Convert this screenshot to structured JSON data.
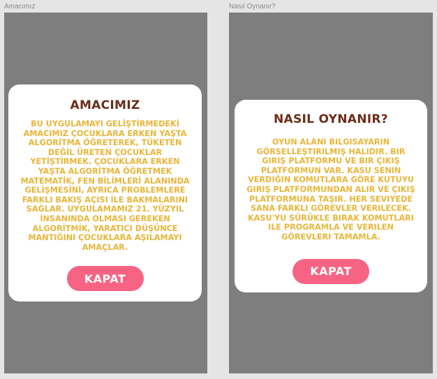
{
  "frames": [
    {
      "label": "Amacımız",
      "title": "AMACIMIZ",
      "body": "BU UYGULAMAYI GELİŞTİRMEDEKİ AMACIMIZ ÇOCUKLARA ERKEN YAŞTA ALGORİTMA ÖĞRETEREK, TÜKETEN DEĞİL ÜRETEN ÇOCUKLAR YETİŞTİRMEK. ÇOCUKLARA ERKEN YAŞTA ALGORİTMA ÖĞRETMEK MATEMATİK, FEN BİLİMLERİ ALANINDA GELİŞMESİNİ, AYRICA PROBLEMLERE FARKLI BAKIŞ AÇISI İLE BAKMALARINI SAĞLAR. UYGULAMAMIZ 21. YÜZYIL İNSANINDA OLMASI GEREKEN ALGORİTMİK, YARATICI DÜŞÜNCE MANTIĞINI ÇOCUKLARA AŞILAMAYI AMAÇLAR.",
      "button": "KAPAT"
    },
    {
      "label": "Nasıl Oynanır?",
      "title": "NASIL OYNANIR?",
      "body": "OYUN ALANI BILGISAYARIN GÖRSELLEŞTIRILMIŞ HALIDIR. BIR GIRIŞ PLATFORMU VE BIR ÇIKIŞ PLATFORMUN VAR. KASU SENIN VERDIĞIN KOMUTLARA GÖRE KUTUYU GIRIŞ PLATFORMUNDAN ALIR VE ÇIKIŞ PLATFORMUNA TAŞIR. HER SEVIYEDE SANA FARKLI GÖREVLER VERILECEK. KASU'YU SÜRÜKLE BIRAK KOMUTLARI ILE PROGRAMLA VE VERILEN GÖREVLERI TAMAMLA.",
      "button": "KAPAT"
    }
  ],
  "colors": {
    "canvas": "#e5e5e5",
    "frame": "#7e7e7e",
    "card": "#ffffff",
    "title": "#6b2d1a",
    "body": "#e8b63a",
    "button": "#f76483",
    "button_text": "#ffffff"
  }
}
